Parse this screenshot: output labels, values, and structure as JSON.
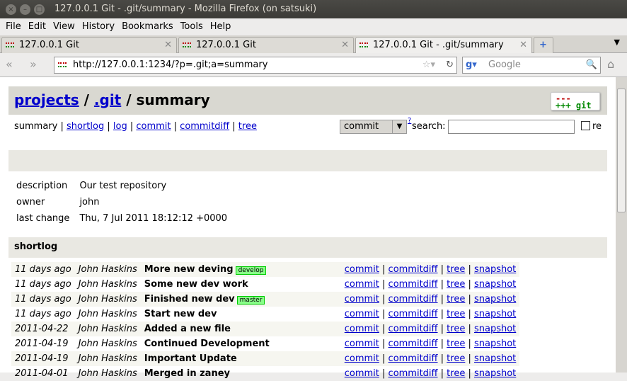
{
  "window": {
    "title": "127.0.0.1 Git - .git/summary - Mozilla Firefox (on satsuki)"
  },
  "menu": [
    "File",
    "Edit",
    "View",
    "History",
    "Bookmarks",
    "Tools",
    "Help"
  ],
  "tabs": [
    {
      "label": "127.0.0.1 Git"
    },
    {
      "label": "127.0.0.1 Git"
    },
    {
      "label": "127.0.0.1 Git - .git/summary",
      "active": true
    }
  ],
  "url": "http://127.0.0.1:1234/?p=.git;a=summary",
  "search_placeholder": "Google",
  "header": {
    "projects": "projects",
    "sep1": " / ",
    "repo": ".git",
    "rest": " / summary",
    "logo_text": "git"
  },
  "nav": {
    "summary": "summary",
    "shortlog": "shortlog",
    "log": "log",
    "commit": "commit",
    "commitdiff": "commitdiff",
    "tree": "tree",
    "search_type": "commit",
    "help": "?",
    "search_label": "search:",
    "re_label": "re"
  },
  "info": [
    {
      "k": "description",
      "v": "Our test repository"
    },
    {
      "k": "owner",
      "v": "john"
    },
    {
      "k": "last change",
      "v": "Thu, 7 Jul 2011 18:12:12 +0000"
    }
  ],
  "shortlog_title": "shortlog",
  "links": [
    "commit",
    "commitdiff",
    "tree",
    "snapshot"
  ],
  "commits": [
    {
      "age": "11 days ago",
      "author": "John Haskins",
      "subject": "More new deving",
      "tag": "develop"
    },
    {
      "age": "11 days ago",
      "author": "John Haskins",
      "subject": "Some new dev work"
    },
    {
      "age": "11 days ago",
      "author": "John Haskins",
      "subject": "Finished new dev",
      "tag": "master"
    },
    {
      "age": "11 days ago",
      "author": "John Haskins",
      "subject": "Start new dev"
    },
    {
      "age": "2011-04-22",
      "author": "John Haskins",
      "subject": "Added a new file"
    },
    {
      "age": "2011-04-19",
      "author": "John Haskins",
      "subject": "Continued Development"
    },
    {
      "age": "2011-04-19",
      "author": "John Haskins",
      "subject": "Important Update"
    },
    {
      "age": "2011-04-01",
      "author": "John Haskins",
      "subject": "Merged in zaney"
    }
  ]
}
